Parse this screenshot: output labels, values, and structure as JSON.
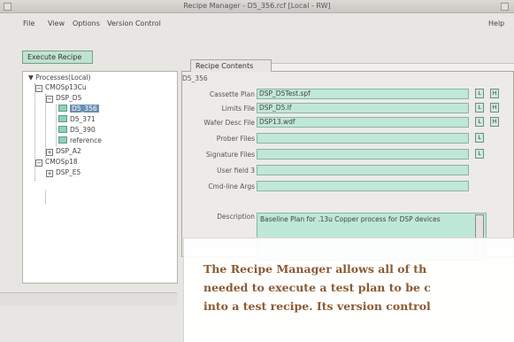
{
  "window": {
    "title": "Recipe Manager - D5_356.rcf [Local - RW]"
  },
  "menubar": {
    "file": "File",
    "view": "View",
    "options": "Options",
    "version_control": "Version Control",
    "help": "Help"
  },
  "toolbar": {
    "execute_label": "Execute Recipe"
  },
  "tree": {
    "root": "Processes(Local)",
    "nodes": [
      {
        "label": "CMOSp13Cu",
        "expander": "−"
      },
      {
        "label": "DSP_D5",
        "expander": "−"
      },
      {
        "label": "D5_356",
        "selected": true
      },
      {
        "label": "D5_371"
      },
      {
        "label": "D5_390"
      },
      {
        "label": "reference"
      },
      {
        "label": "DSP_A2",
        "expander": "+"
      },
      {
        "label": "CMOSp18",
        "expander": "−"
      },
      {
        "label": "DSP_E5",
        "expander": "+"
      }
    ]
  },
  "tabs": {
    "recipe_contents": "Recipe Contents"
  },
  "group": {
    "title": "D5_356"
  },
  "fields": [
    {
      "label": "Cassette Plan",
      "value": "DSP_D5Test.spf",
      "buttons": [
        "L",
        "H"
      ]
    },
    {
      "label": "Limits File",
      "value": "DSP_D5.lf",
      "buttons": [
        "L",
        "H"
      ]
    },
    {
      "label": "Wafer Desc File",
      "value": "DSP13.wdf",
      "buttons": [
        "L",
        "H"
      ]
    },
    {
      "label": "Prober Files",
      "value": "",
      "buttons": [
        "L"
      ]
    },
    {
      "label": "Signature Files",
      "value": "",
      "buttons": [
        "L"
      ]
    },
    {
      "label": "User field 3",
      "value": "",
      "buttons": []
    },
    {
      "label": "Cmd-line Args",
      "value": "",
      "buttons": []
    }
  ],
  "description": {
    "label": "Description",
    "value": "Baseline Plan for .13u Copper process for DSP devices"
  },
  "overlay": {
    "line1": "The Recipe Manager allows all of th",
    "line2": "needed to execute a test plan to be c",
    "line3": "into a test recipe. Its version control"
  }
}
